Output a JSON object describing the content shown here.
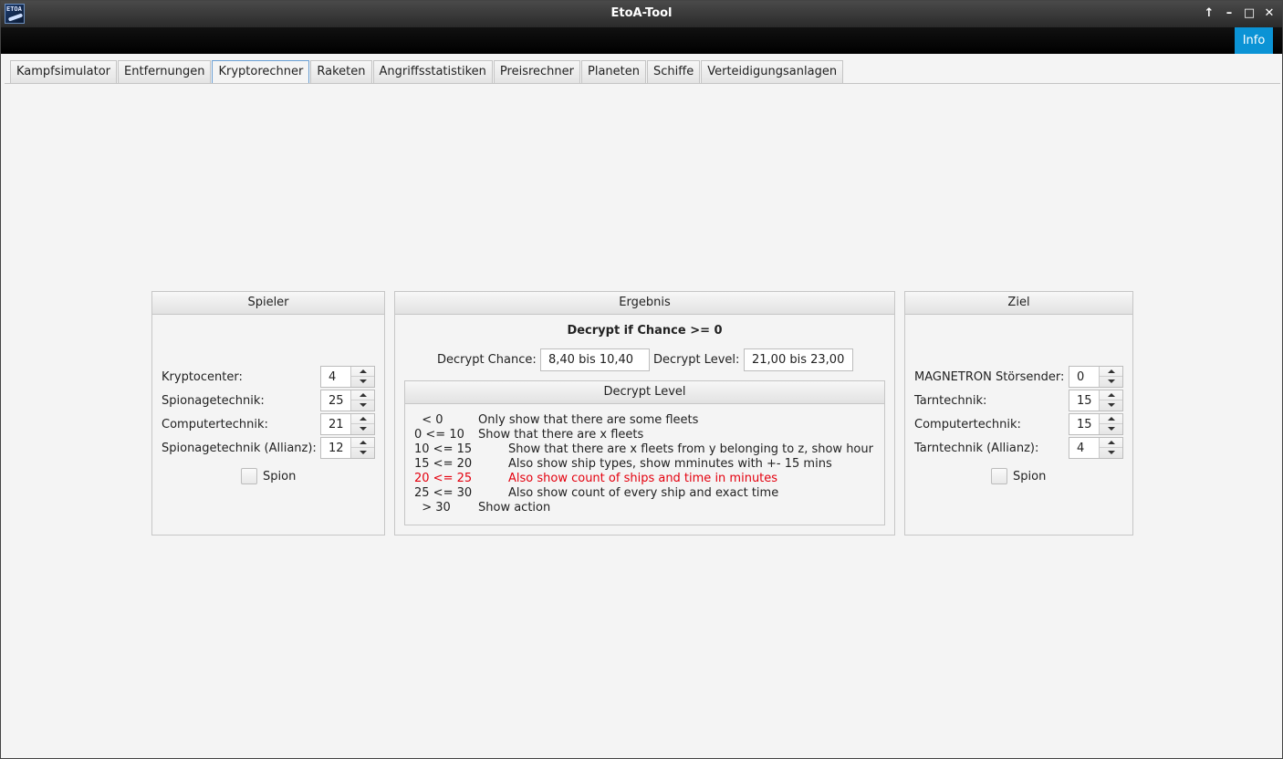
{
  "window": {
    "title": "EtoA-Tool",
    "icon_text": "ETOA"
  },
  "toolbar": {
    "info_label": "Info"
  },
  "tabs": [
    {
      "label": "Kampfsimulator"
    },
    {
      "label": "Entfernungen"
    },
    {
      "label": "Kryptorechner",
      "active": true
    },
    {
      "label": "Raketen"
    },
    {
      "label": "Angriffsstatistiken"
    },
    {
      "label": "Preisrechner"
    },
    {
      "label": "Planeten"
    },
    {
      "label": "Schiffe"
    },
    {
      "label": "Verteidigungsanlagen"
    }
  ],
  "spieler": {
    "title": "Spieler",
    "fields": [
      {
        "label": "Kryptocenter:",
        "value": "4"
      },
      {
        "label": "Spionagetechnik:",
        "value": "25"
      },
      {
        "label": "Computertechnik:",
        "value": "21"
      },
      {
        "label": "Spionagetechnik (Allianz):",
        "value": "12"
      }
    ],
    "checkbox_label": "Spion"
  },
  "ergebnis": {
    "title": "Ergebnis",
    "headline": "Decrypt if Chance >= 0",
    "chance_label": "Decrypt Chance:",
    "chance_value": "8,40 bis 10,40",
    "level_label": "Decrypt Level:",
    "level_value": "21,00 bis 23,00",
    "level_panel": {
      "title": "Decrypt Level",
      "rows": [
        {
          "range": "  < 0",
          "text": "Only show that there are some fleets",
          "indent": false,
          "highlight": false
        },
        {
          "range": "0 <= 10",
          "text": "Show that there are x fleets",
          "indent": false,
          "highlight": false
        },
        {
          "range": "10 <= 15",
          "text": "Show that there are x fleets from y belonging to z, show hour",
          "indent": true,
          "highlight": false
        },
        {
          "range": "15 <= 20",
          "text": "Also show ship types, show mminutes with +- 15 mins",
          "indent": true,
          "highlight": false
        },
        {
          "range": "20 <= 25",
          "text": "Also show count of ships and time in minutes",
          "indent": true,
          "highlight": true
        },
        {
          "range": "25 <= 30",
          "text": "Also show count of every ship and exact time",
          "indent": true,
          "highlight": false
        },
        {
          "range": "  > 30",
          "text": "Show action",
          "indent": false,
          "highlight": false
        }
      ]
    }
  },
  "ziel": {
    "title": "Ziel",
    "fields": [
      {
        "label": "MAGNETRON Störsender:",
        "value": "0"
      },
      {
        "label": "Tarntechnik:",
        "value": "15"
      },
      {
        "label": "Computertechnik:",
        "value": "15"
      },
      {
        "label": "Tarntechnik (Allianz):",
        "value": "4"
      }
    ],
    "checkbox_label": "Spion"
  },
  "colors": {
    "accent": "#0b93d5",
    "highlight": "#e4000e"
  }
}
